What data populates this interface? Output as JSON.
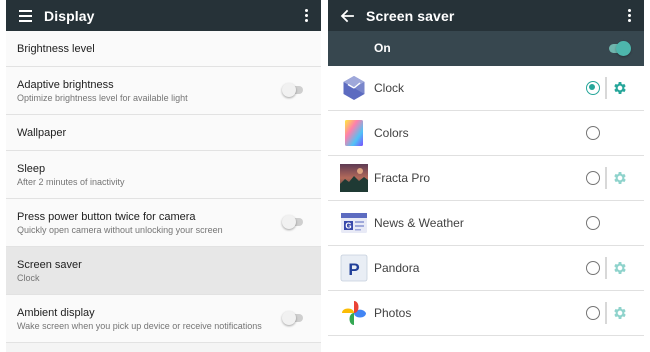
{
  "display": {
    "title": "Display",
    "settings": [
      {
        "title": "Brightness level",
        "subtitle": ""
      },
      {
        "title": "Adaptive brightness",
        "subtitle": "Optimize brightness level for available light",
        "toggle": false
      },
      {
        "title": "Wallpaper",
        "subtitle": ""
      },
      {
        "title": "Sleep",
        "subtitle": "After 2 minutes of inactivity"
      },
      {
        "title": "Press power button twice for camera",
        "subtitle": "Quickly open camera without unlocking your screen",
        "toggle": false
      },
      {
        "title": "Screen saver",
        "subtitle": "Clock",
        "selected": true
      },
      {
        "title": "Ambient display",
        "subtitle": "Wake screen when you pick up device or receive notifications",
        "toggle": false
      }
    ]
  },
  "screensaver": {
    "title": "Screen saver",
    "master_label": "On",
    "master_on": true,
    "accent_color": "#26a69a",
    "items": [
      {
        "name": "Clock",
        "icon": "clock-icon",
        "selected": true,
        "has_settings": true
      },
      {
        "name": "Colors",
        "icon": "colors-icon",
        "selected": false,
        "has_settings": false
      },
      {
        "name": "Fracta Pro",
        "icon": "fracta-pro-icon",
        "selected": false,
        "has_settings": true
      },
      {
        "name": "News & Weather",
        "icon": "news-weather-icon",
        "selected": false,
        "has_settings": false
      },
      {
        "name": "Pandora",
        "icon": "pandora-icon",
        "selected": false,
        "has_settings": true
      },
      {
        "name": "Photos",
        "icon": "photos-icon",
        "selected": false,
        "has_settings": true
      }
    ]
  }
}
